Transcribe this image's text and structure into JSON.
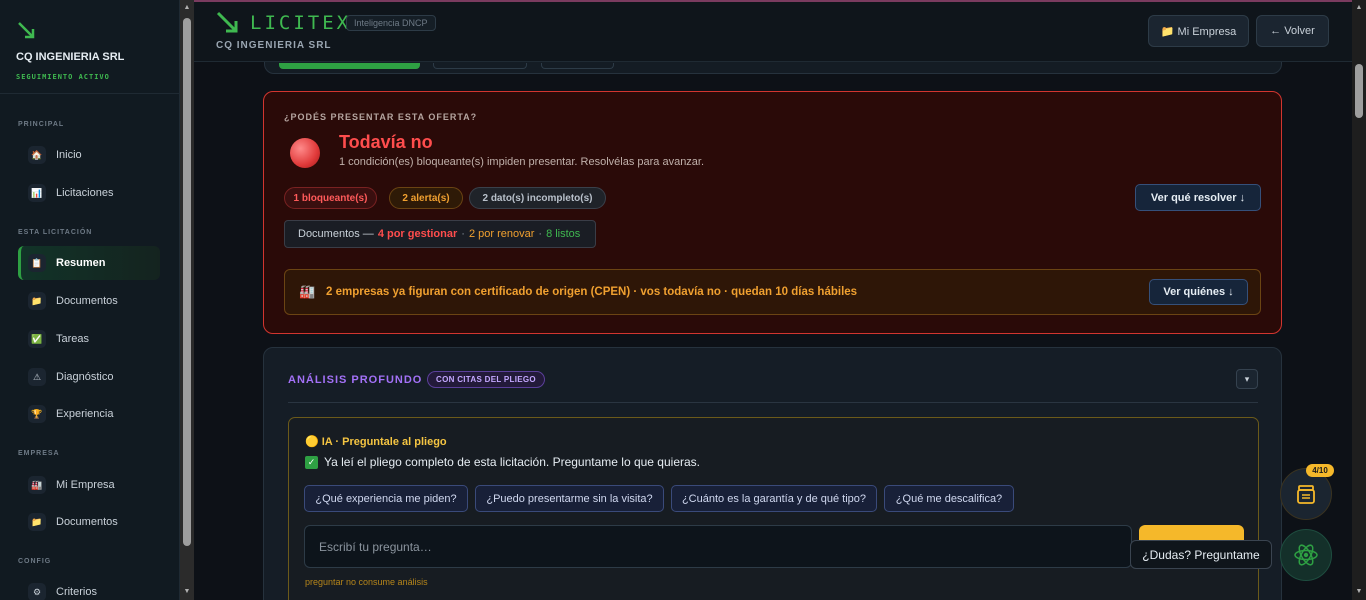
{
  "sidebar": {
    "company": "CQ INGENIERIA SRL",
    "status": "SEGUIMIENTO ACTIVO",
    "sections": {
      "principal": "PRINCIPAL",
      "licitacion": "ESTA LICITACIÓN",
      "empresa": "EMPRESA",
      "config": "CONFIG"
    },
    "items": {
      "inicio": "Inicio",
      "licitaciones": "Licitaciones",
      "resumen": "Resumen",
      "documentos": "Documentos",
      "tareas": "Tareas",
      "diagnostico": "Diagnóstico",
      "experiencia": "Experiencia",
      "mi_empresa": "Mi Empresa",
      "documentos_empresa": "Documentos",
      "criterios": "Criterios"
    },
    "icons": {
      "inicio": "🏠",
      "licitaciones": "📊",
      "resumen": "📋",
      "documentos": "📁",
      "tareas": "✅",
      "diagnostico": "⚠",
      "experiencia": "🏆",
      "mi_empresa": "🏭",
      "documentos_empresa": "📁",
      "criterios": "⚙"
    }
  },
  "header": {
    "logo_text": "LICITEX",
    "tag": "Inteligencia DNCP",
    "subtitle": "CQ INGENIERIA SRL",
    "btn_mi_empresa": "📁 Mi Empresa",
    "btn_volver": "← Volver"
  },
  "alert": {
    "question": "¿PODÉS PRESENTAR ESTA OFERTA?",
    "title": "Todavía no",
    "description": "1 condición(es) bloqueante(s) impiden presentar. Resolvélas para avanzar.",
    "pill_blocking": "1 bloqueante(s)",
    "pill_alerts": "2 alerta(s)",
    "pill_incomplete": "2 dato(s) incompleto(s)",
    "resolve_btn": "Ver qué resolver ↓",
    "docs_label": "Documentos —",
    "docs_manage": "4 por gestionar",
    "docs_sep": "·",
    "docs_renew": "2 por renovar",
    "docs_ready": "8 listos",
    "cpen_icon": "🏭",
    "cpen_text": "2 empresas ya figuran con certificado de origen (CPEN) · vos todavía no · quedan 10 días hábiles",
    "cpen_btn": "Ver quiénes ↓"
  },
  "deep": {
    "title": "ANÁLISIS PROFUNDO",
    "badge": "CON CITAS DEL PLIEGO",
    "toggle": "▾"
  },
  "ia": {
    "head": "🟡 IA · Preguntale al pliego",
    "message": "Ya leí el pliego completo de esta licitación. Preguntame lo que quieras.",
    "chips": [
      "¿Qué experiencia me piden?",
      "¿Puedo presentarme sin la visita?",
      "¿Cuánto es la garantía y de qué tipo?",
      "¿Qué me descalifica?"
    ],
    "placeholder": "Escribí tu pregunta…",
    "note": "preguntar no consume análisis"
  },
  "floating": {
    "badge": "4/10",
    "tooltip": "¿Dudas? Preguntame"
  },
  "colors": {
    "accent_green": "#3fb950",
    "danger": "#ff4d4d",
    "warning": "#f0a030",
    "purple": "#a371f7",
    "gold": "#f5b82a"
  }
}
